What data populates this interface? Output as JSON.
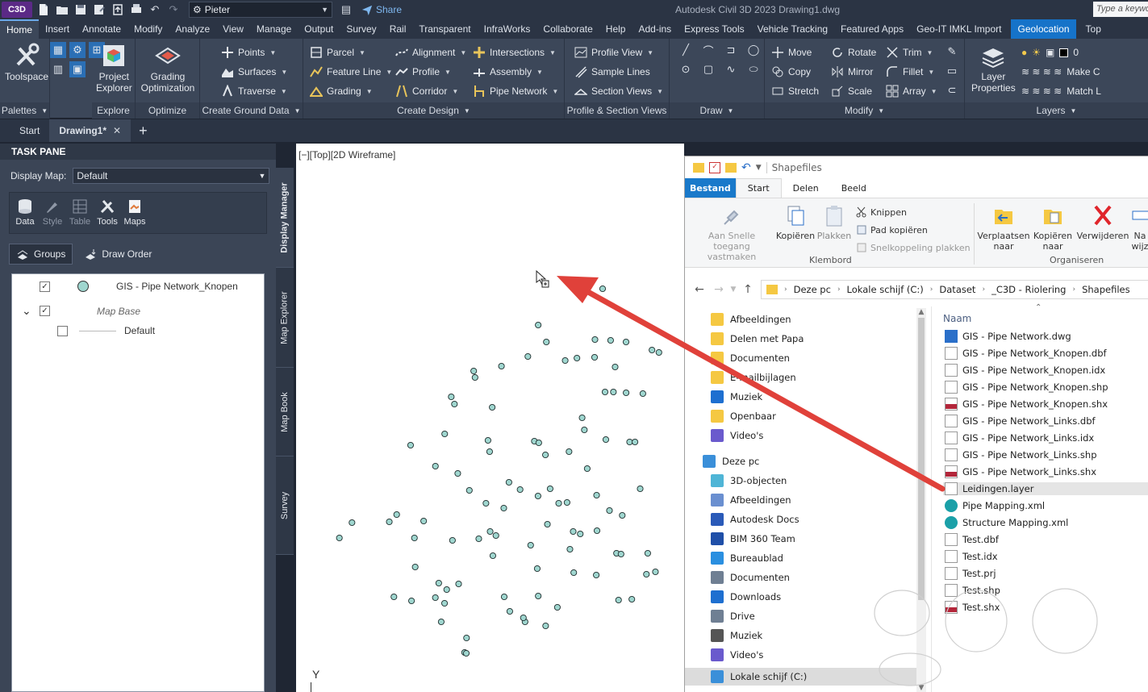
{
  "app": {
    "badge": "C3D",
    "title": "Autodesk Civil 3D 2023    Drawing1.dwg",
    "user": "Pieter",
    "share": "Share",
    "keyword_placeholder": "Type a keyword"
  },
  "ribbon_tabs": [
    "Home",
    "Insert",
    "Annotate",
    "Modify",
    "Analyze",
    "View",
    "Manage",
    "Output",
    "Survey",
    "Rail",
    "Transparent",
    "InfraWorks",
    "Collaborate",
    "Help",
    "Add-ins",
    "Express Tools",
    "Vehicle Tracking",
    "Featured Apps",
    "Geo-IT IMKL Import",
    "Geolocation",
    "Top"
  ],
  "ribbon": {
    "palettes": {
      "toolspace": "Toolspace",
      "title": "Palettes"
    },
    "explore": {
      "project_explorer_1": "Project",
      "project_explorer_2": "Explorer",
      "title": "Explore"
    },
    "optimize": {
      "grading_1": "Grading",
      "grading_2": "Optimization",
      "title": "Optimize"
    },
    "ground": {
      "points": "Points",
      "surfaces": "Surfaces",
      "traverse": "Traverse",
      "title": "Create Ground Data"
    },
    "design": {
      "parcel": "Parcel",
      "feature_line": "Feature Line",
      "grading": "Grading",
      "alignment": "Alignment",
      "profile": "Profile",
      "corridor": "Corridor",
      "intersections": "Intersections",
      "assembly": "Assembly",
      "pipe_network": "Pipe Network",
      "title": "Create Design"
    },
    "profile_section": {
      "profile_view": "Profile View",
      "sample_lines": "Sample Lines",
      "section_views": "Section Views",
      "title": "Profile & Section Views"
    },
    "draw": {
      "title": "Draw"
    },
    "modify": {
      "move": "Move",
      "rotate": "Rotate",
      "trim": "Trim",
      "copy": "Copy",
      "mirror": "Mirror",
      "fillet": "Fillet",
      "stretch": "Stretch",
      "scale": "Scale",
      "array": "Array",
      "title": "Modify"
    },
    "layers": {
      "layer_props_1": "Layer",
      "layer_props_2": "Properties",
      "layer_value": "0",
      "make_current": "Make C",
      "match": "Match L",
      "title": "Layers"
    }
  },
  "doc_tabs": {
    "start": "Start",
    "drawing": "Drawing1*"
  },
  "task_pane": {
    "title": "TASK PANE",
    "display_map_label": "Display Map:",
    "display_map_value": "Default",
    "tools": [
      "Data",
      "Style",
      "Table",
      "Tools",
      "Maps"
    ],
    "subtabs": {
      "groups": "Groups",
      "draw_order": "Draw Order"
    },
    "layers": [
      {
        "name": "GIS - Pipe Network_Knopen",
        "checked": true
      },
      {
        "name": "Map Base",
        "checked": true
      },
      {
        "name": "Default",
        "checked": false
      }
    ],
    "side_tabs": [
      "Display Manager",
      "Map Explorer",
      "Map Book",
      "Survey"
    ]
  },
  "viewport": {
    "label": "[−][Top][2D Wireframe]",
    "ucs_y": "Y"
  },
  "explorer": {
    "title": "Shapefiles",
    "tabs": {
      "file": "Bestand",
      "start": "Start",
      "share": "Delen",
      "view": "Beeld"
    },
    "clipboard": {
      "pin_1": "Aan Snelle toegang",
      "pin_2": "vastmaken",
      "copy": "Kopiëren",
      "paste": "Plakken",
      "cut": "Knippen",
      "copy_path": "Pad kopiëren",
      "paste_shortcut": "Snelkoppeling plakken",
      "title": "Klembord"
    },
    "organise": {
      "move_1": "Verplaatsen",
      "move_2": "naar",
      "copy_1": "Kopiëren",
      "copy_2": "naar",
      "delete": "Verwijderen",
      "rename_1": "Na",
      "rename_2": "wijz",
      "title": "Organiseren"
    },
    "path": [
      "Deze pc",
      "Lokale schijf (C:)",
      "Dataset",
      "_C3D - Riolering",
      "Shapefiles"
    ],
    "nav_items": [
      "Afbeeldingen",
      "Delen met Papa",
      "Documenten",
      "E-mailbijlagen",
      "Muziek",
      "Openbaar",
      "Video's",
      "Deze pc",
      "3D-objecten",
      "Afbeeldingen",
      "Autodesk Docs",
      "BIM 360 Team",
      "Bureaublad",
      "Documenten",
      "Downloads",
      "Drive",
      "Muziek",
      "Video's",
      "Lokale schijf (C:)"
    ],
    "column_name": "Naam",
    "files": [
      "GIS - Pipe Network.dwg",
      "GIS - Pipe Network_Knopen.dbf",
      "GIS - Pipe Network_Knopen.idx",
      "GIS - Pipe Network_Knopen.shp",
      "GIS - Pipe Network_Knopen.shx",
      "GIS - Pipe Network_Links.dbf",
      "GIS - Pipe Network_Links.idx",
      "GIS - Pipe Network_Links.shp",
      "GIS - Pipe Network_Links.shx",
      "Leidingen.layer",
      "Pipe Mapping.xml",
      "Structure Mapping.xml",
      "Test.dbf",
      "Test.idx",
      "Test.prj",
      "Test.shp",
      "Test.shx"
    ],
    "selected_file": "Leidingen.layer"
  },
  "colors": {
    "accent": "#1673c9",
    "node_fill": "#9fd6cf",
    "arrow": "#e0413a",
    "ribbon_bg": "#3c4759"
  }
}
